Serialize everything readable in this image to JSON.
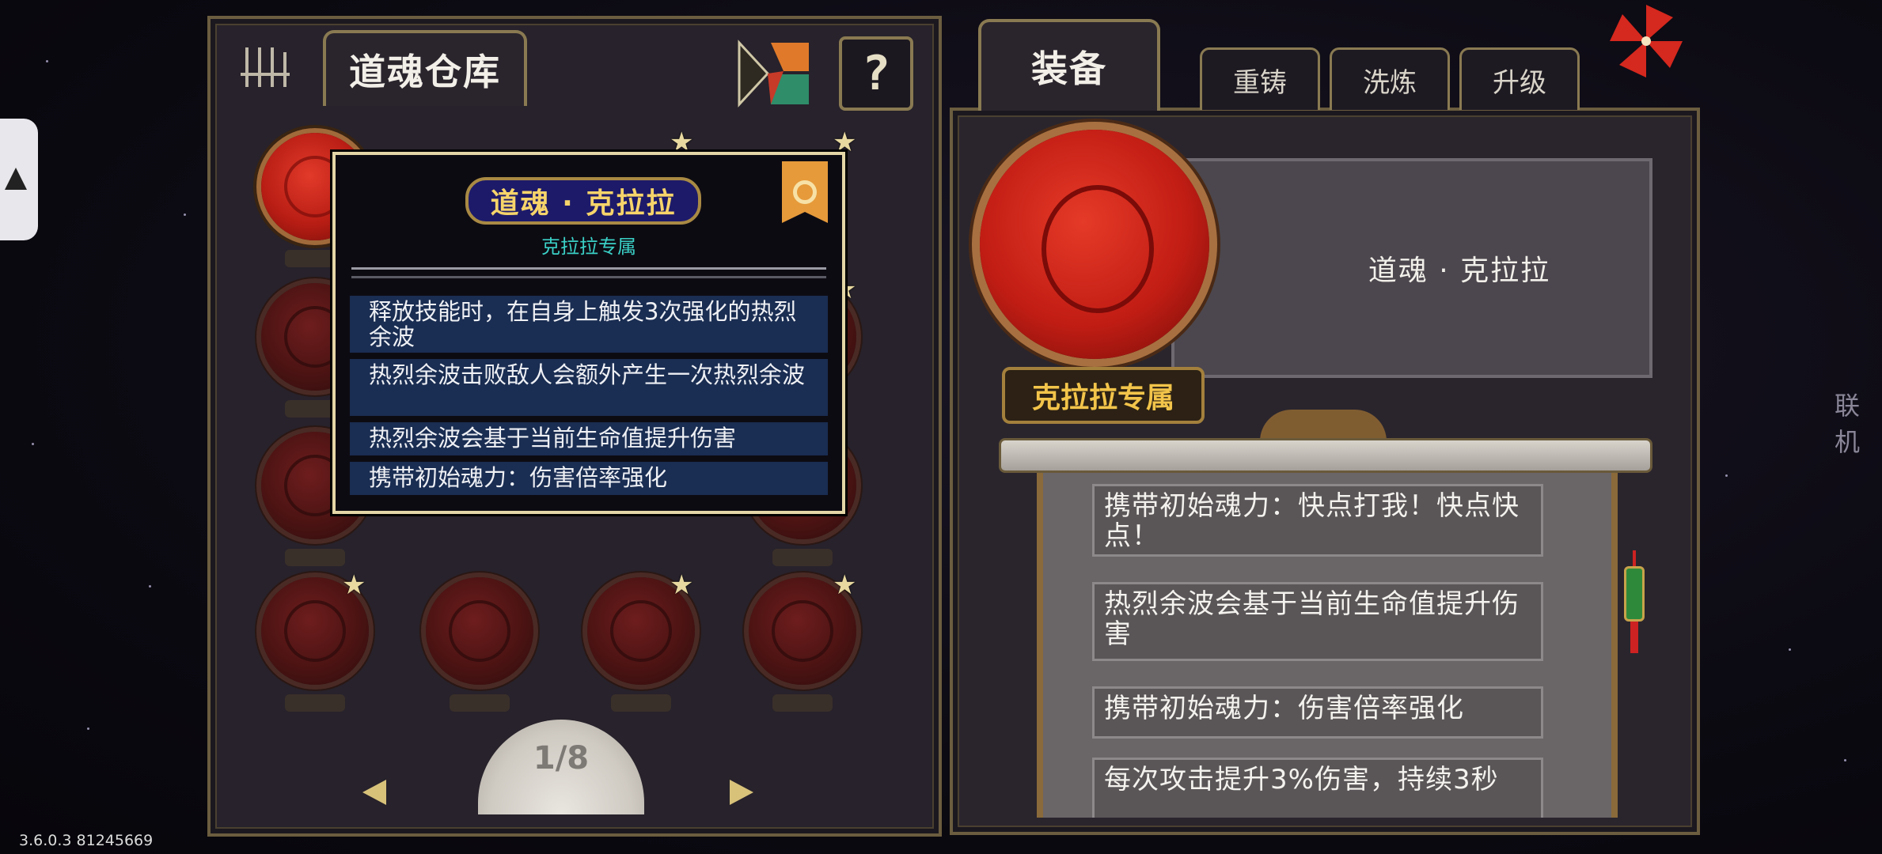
{
  "left_panel": {
    "title": "道魂仓库",
    "page_indicator": "1/8"
  },
  "right_panel": {
    "tabs": [
      {
        "label": "装备",
        "active": true
      },
      {
        "label": "重铸",
        "active": false
      },
      {
        "label": "洗炼",
        "active": false
      },
      {
        "label": "升级",
        "active": false
      }
    ],
    "item_name": "道魂 · 克拉拉",
    "exclusive_label": "克拉拉专属",
    "effects": [
      "携带初始魂力：快点打我！快点快点！",
      "热烈余波会基于当前生命值提升伤害",
      "携带初始魂力：伤害倍率强化",
      "每次攻击提升3%伤害，持续3秒"
    ]
  },
  "tooltip": {
    "title": "道魂 · 克拉拉",
    "subtitle": "克拉拉专属",
    "lines": [
      "释放技能时，在自身上触发3次强化的热烈余波",
      "热烈余波击败敌人会额外产生一次热烈余波",
      "热烈余波会基于当前生命值提升伤害",
      "携带初始魂力：伤害倍率强化"
    ]
  },
  "side_text": "联机",
  "version": "3.6.0.3 81245669",
  "colors": {
    "panel_bg": "#27222b",
    "gold_trim": "#8a7a52",
    "tooltip_title_bg": "#1d1a6a",
    "tooltip_title_text": "#f6d46a",
    "tooltip_sub_text": "#3ad0c6",
    "exclusive_text": "#f2c44a",
    "orb_active": "#d0281c"
  },
  "icons": [
    "help-icon",
    "puzzle-icon",
    "prev-arrow-icon",
    "next-arrow-icon",
    "pinwheel-icon",
    "star-icon",
    "bookmark-badge-icon"
  ]
}
